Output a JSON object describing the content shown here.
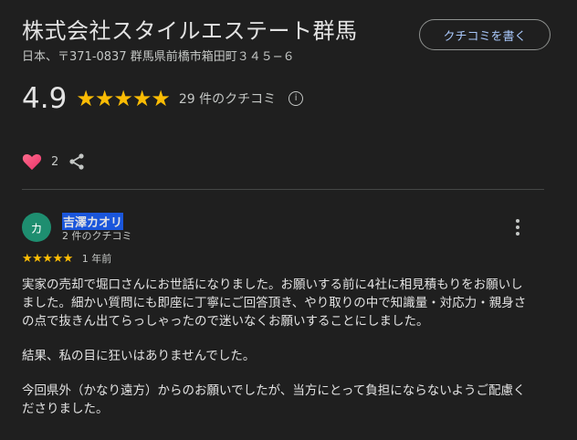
{
  "place": {
    "name": "株式会社スタイルエステート群馬",
    "address": "日本、〒371-0837 群馬県前橋市箱田町３４５−６",
    "write_review_label": "クチコミを書く"
  },
  "summary": {
    "rating": "4.9",
    "stars": "★★★★★",
    "review_count_text": "29 件のクチコミ",
    "info_icon": "info-icon"
  },
  "reactions": {
    "count": "2",
    "heart_icon": "heart-icon",
    "share_icon": "share-icon"
  },
  "review": {
    "avatar_letter": "カ",
    "avatar_color": "#1e8e70",
    "author": "吉澤カオリ",
    "author_meta": "2 件のクチコミ",
    "stars": "★★★★★",
    "date": "1 年前",
    "paragraphs": [
      "実家の売却で堀口さんにお世話になりました。お願いする前に4社に相見積もりをお願いしました。細かい質問にも即座に丁寧にご回答頂き、やり取りの中で知識量・対応力・親身さの点で抜きん出てらっしゃったので迷いなくお願いすることにしました。",
      "結果、私の目に狂いはありませんでした。",
      "今回県外（かなり遠方）からのお願いでしたが、当方にとって負担にならないようご配慮くださりました。"
    ]
  },
  "colors": {
    "background": "#1f1f1f",
    "star": "#fbbc04",
    "link": "#a8c7fa",
    "selection": "#1a56db"
  }
}
